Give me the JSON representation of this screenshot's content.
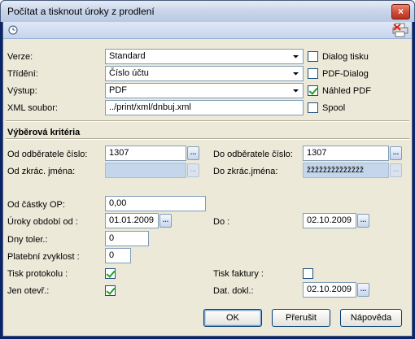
{
  "window": {
    "title": "Počítat a tisknout úroky z prodlení",
    "close": "×"
  },
  "toolbar": {
    "left_icon": "clock-icon",
    "right_icon": "print-icon"
  },
  "output": {
    "verze_label": "Verze:",
    "verze_value": "Standard",
    "trideni_label": "Třídění:",
    "trideni_value": "Číslo účtu",
    "vystup_label": "Výstup:",
    "vystup_value": "PDF",
    "xml_label": "XML soubor:",
    "xml_value": "../print/xml/dnbuj.xml",
    "dialog_tisku_label": "Dialog tisku",
    "dialog_tisku_checked": false,
    "pdf_dialog_label": "PDF-Dialog",
    "pdf_dialog_checked": false,
    "nahled_pdf_label": "Náhled PDF",
    "nahled_pdf_checked": true,
    "spool_label": "Spool",
    "spool_checked": false
  },
  "criteria": {
    "section_title": "Výběrová kritéria",
    "od_odberatele_label": "Od odběratele číslo:",
    "od_odberatele_value": "1307",
    "do_odberatele_label": "Do odběratele číslo:",
    "do_odberatele_value": "1307",
    "od_jmena_label": "Od zkrác. jména:",
    "od_jmena_value": "",
    "do_jmena_label": "Do zkrác.jména:",
    "do_jmena_value": "žžžžžžžžžžžžžž",
    "od_castky_label": "Od částky OP:",
    "od_castky_value": "0,00",
    "uroky_od_label": "Úroky období od :",
    "uroky_od_value": "01.01.2009",
    "do_label": "Do :",
    "do_value": "02.10.2009",
    "dny_toler_label": "Dny toler.:",
    "dny_toler_value": "0",
    "platebni_label": "Platební zvyklost :",
    "platebni_value": "0",
    "tisk_protokolu_label": "Tisk protokolu :",
    "tisk_protokolu_checked": true,
    "tisk_faktury_label": "Tisk faktury :",
    "tisk_faktury_checked": false,
    "jen_otevr_label": "Jen otevř.:",
    "jen_otevr_checked": true,
    "dat_dokl_label": "Dat. dokl.:",
    "dat_dokl_value": "02.10.2009"
  },
  "buttons": {
    "ok": "OK",
    "prerusit": "Přerušit",
    "napoveda": "Nápověda"
  },
  "dots": "..."
}
